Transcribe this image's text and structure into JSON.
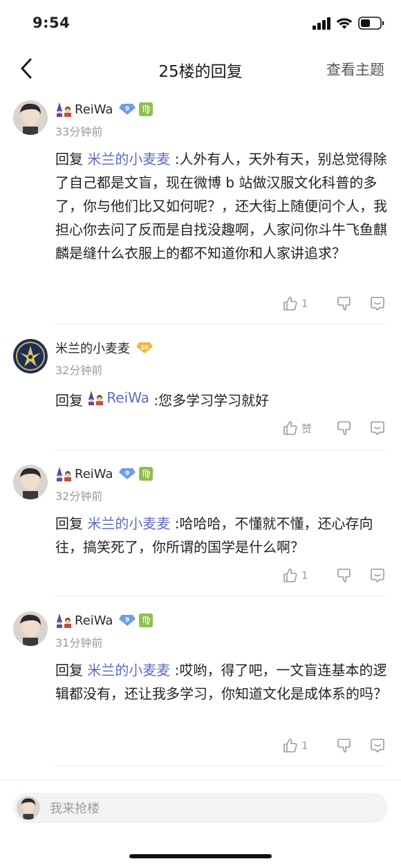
{
  "status_bar": {
    "time": "9:54",
    "icons": [
      "signal-icon",
      "wifi-icon",
      "battery-icon"
    ]
  },
  "nav": {
    "title": "25楼的回复",
    "action": "查看主题",
    "back_icon": "chevron-left-icon"
  },
  "colors": {
    "mention": "#5e6cc4",
    "muted": "#9a9a9a",
    "level_badge": "#6d9ee8",
    "gold_badge": "#f1b73a",
    "zodiac": "#8fbf4f"
  },
  "replies": [
    {
      "username": "ReiWa",
      "level": "9",
      "zodiac": "♍",
      "time": "33分钟前",
      "prefix": "回复 ",
      "mention": "米兰的小麦麦",
      "text": " :人外有人，天外有天，别总觉得除了自己都是文盲，现在微博 b 站做汉服文化科普的多了，你与他们比又如何呢？，还大街上随便问个人，我担心你去问了反而是自找没趣啊，人家问你斗牛飞鱼麒麟是缝什么衣服上的都不知道你和人家讲追求？",
      "likes": "1"
    },
    {
      "username": "米兰的小麦麦",
      "level": "10",
      "time": "32分钟前",
      "prefix": "回复 ",
      "mention": "ReiWa",
      "text": " :您多学习学习就好",
      "likes": "赞"
    },
    {
      "username": "ReiWa",
      "level": "9",
      "zodiac": "♍",
      "time": "32分钟前",
      "prefix": "回复 ",
      "mention": "米兰的小麦麦",
      "text": " :哈哈哈，不懂就不懂，还心存向往，搞笑死了，你所谓的国学是什么啊？",
      "likes": "1"
    },
    {
      "username": "ReiWa",
      "level": "9",
      "zodiac": "♍",
      "time": "31分钟前",
      "prefix": "回复 ",
      "mention": "米兰的小麦麦",
      "text": " :哎哟，得了吧，一文盲连基本的逻辑都没有，还让我多学习，你知道文化是成体系的吗？",
      "likes": "1"
    }
  ],
  "bottom": {
    "placeholder": "我来抢楼"
  }
}
